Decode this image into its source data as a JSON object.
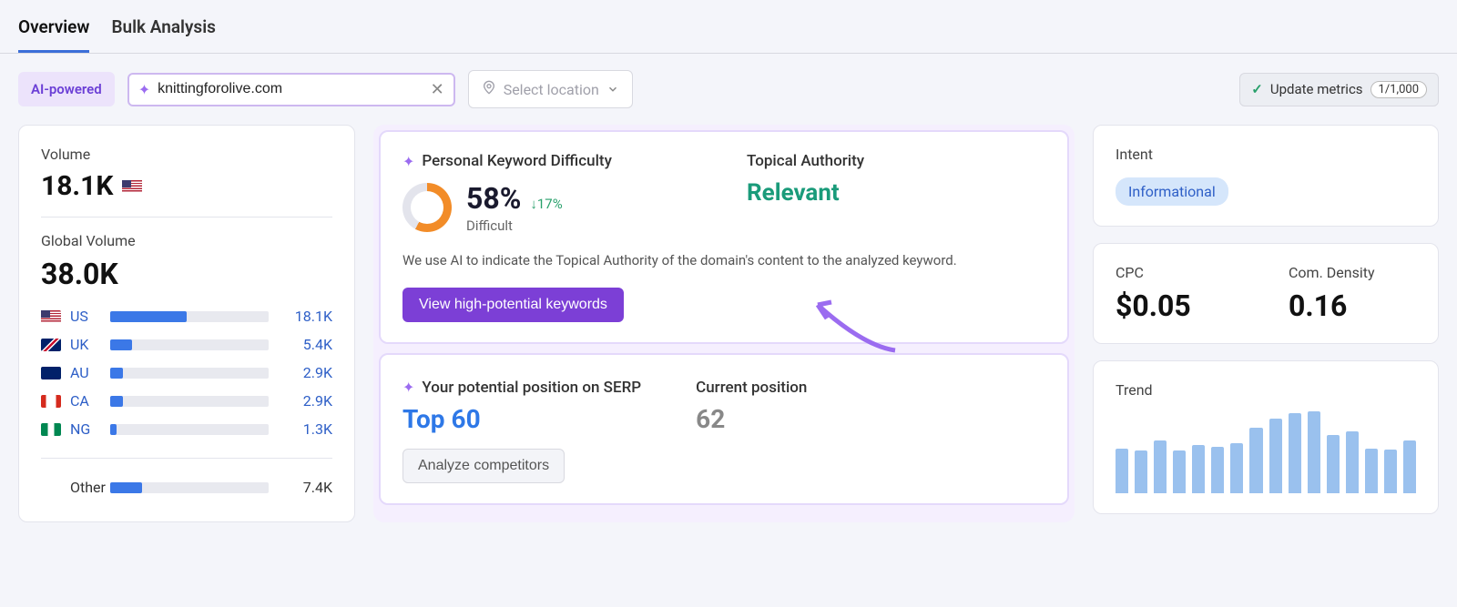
{
  "tabs": {
    "overview": "Overview",
    "bulk": "Bulk Analysis"
  },
  "toolbar": {
    "ai_badge": "AI-powered",
    "domain_value": "knittingforolive.com",
    "location_placeholder": "Select location",
    "update_label": "Update metrics",
    "update_count": "1/1,000"
  },
  "volume": {
    "label": "Volume",
    "value": "18.1K",
    "global_label": "Global Volume",
    "global_value": "38.0K",
    "countries": [
      {
        "flag": "us",
        "code": "US",
        "bar": 48,
        "value": "18.1K",
        "link": true
      },
      {
        "flag": "uk",
        "code": "UK",
        "bar": 14,
        "value": "5.4K",
        "link": true
      },
      {
        "flag": "au",
        "code": "AU",
        "bar": 8,
        "value": "2.9K",
        "link": true
      },
      {
        "flag": "ca",
        "code": "CA",
        "bar": 8,
        "value": "2.9K",
        "link": true
      },
      {
        "flag": "ng",
        "code": "NG",
        "bar": 4,
        "value": "1.3K",
        "link": true
      }
    ],
    "other_label": "Other",
    "other_bar": 20,
    "other_value": "7.4K"
  },
  "pkd": {
    "title": "Personal Keyword Difficulty",
    "pct": "58%",
    "delta": "↓17%",
    "difficulty_label": "Difficult",
    "ta_title": "Topical Authority",
    "ta_value": "Relevant",
    "desc": "We use AI to indicate the Topical Authority of the domain's content to the analyzed keyword.",
    "cta": "View high-potential keywords"
  },
  "serp": {
    "title": "Your potential position on SERP",
    "potential": "Top 60",
    "current_title": "Current position",
    "current": "62",
    "cta": "Analyze competitors"
  },
  "intent": {
    "label": "Intent",
    "value": "Informational"
  },
  "metrics": {
    "cpc_label": "CPC",
    "cpc_value": "$0.05",
    "density_label": "Com. Density",
    "density_value": "0.16"
  },
  "trend": {
    "label": "Trend",
    "bars": [
      42,
      40,
      50,
      40,
      45,
      44,
      47,
      62,
      70,
      75,
      77,
      55,
      58,
      42,
      41,
      50
    ]
  },
  "chart_data": {
    "type": "bar",
    "title": "Trend",
    "values": [
      42,
      40,
      50,
      40,
      45,
      44,
      47,
      62,
      70,
      75,
      77,
      55,
      58,
      42,
      41,
      50
    ]
  }
}
